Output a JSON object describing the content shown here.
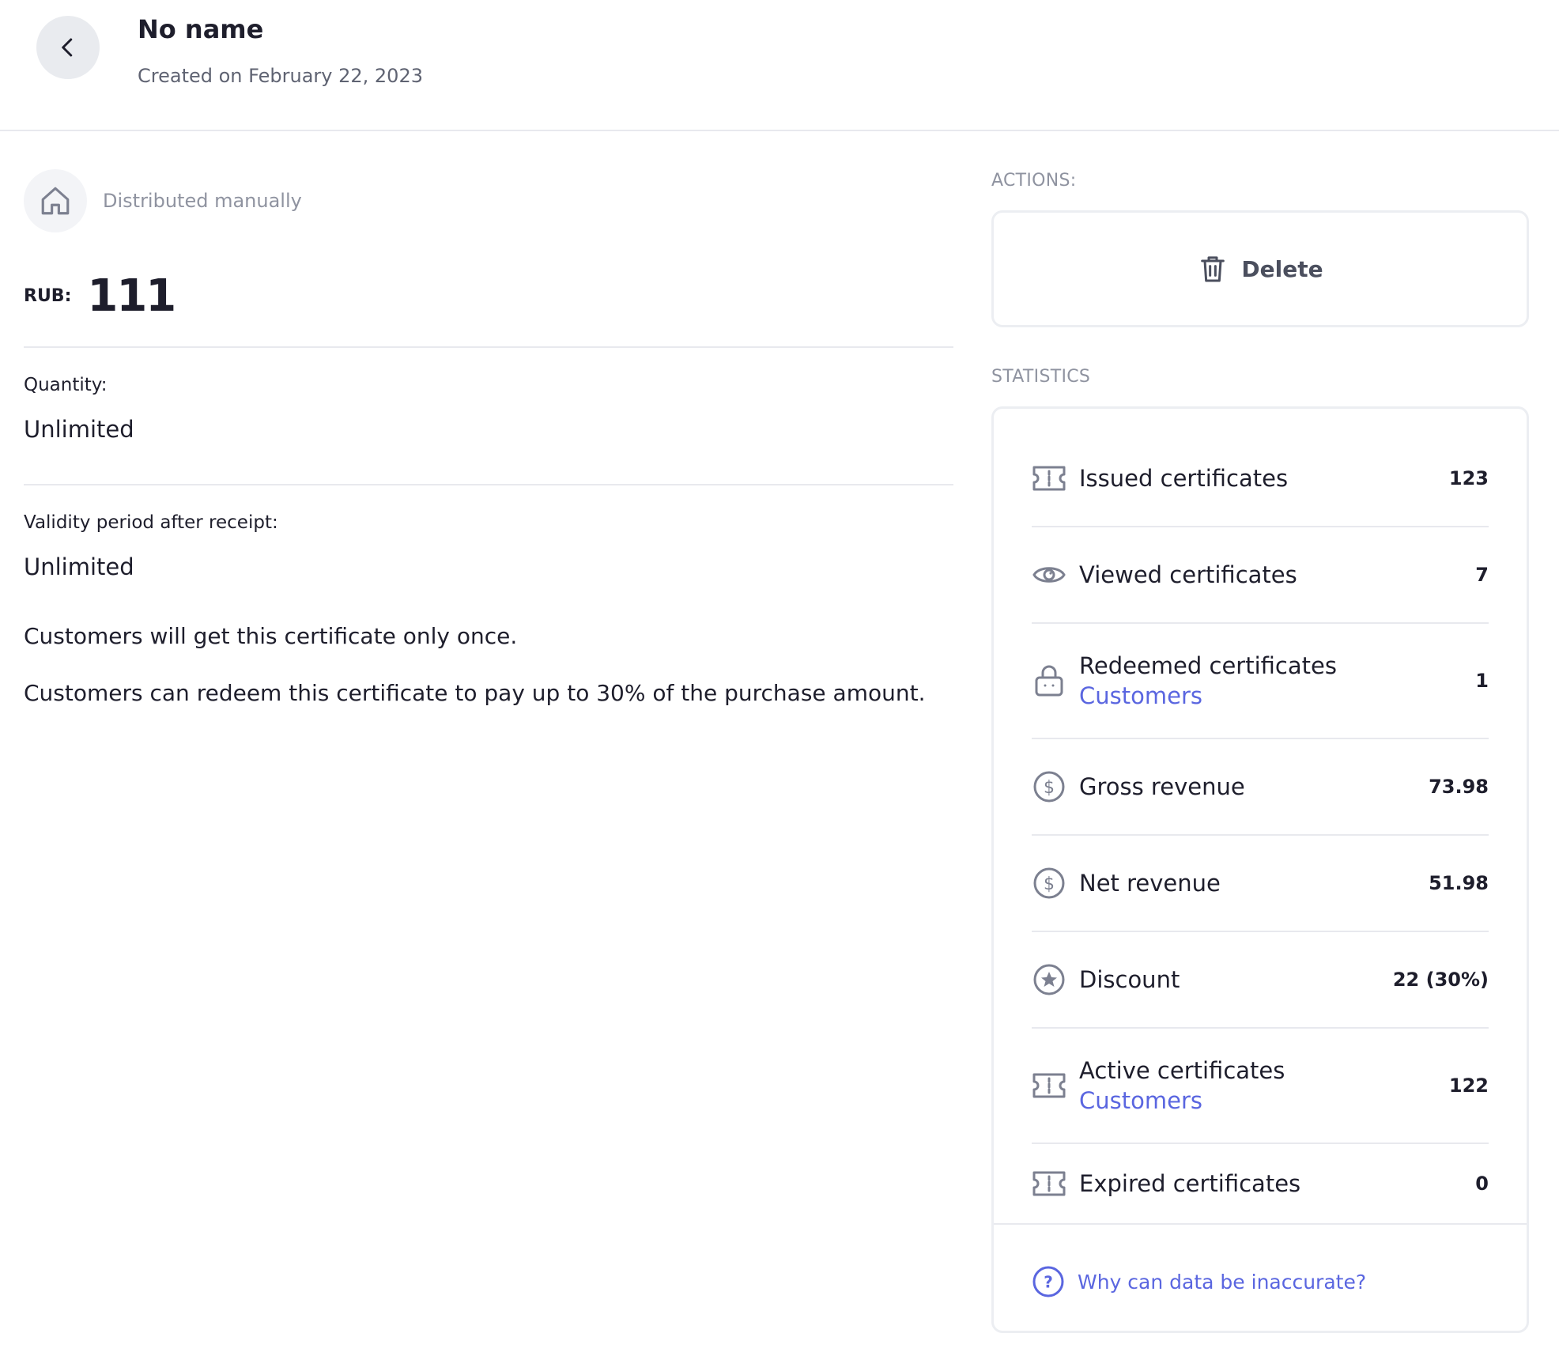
{
  "header": {
    "title": "No name",
    "subtitle": "Created on February 22, 2023"
  },
  "distribution": {
    "label": "Distributed manually",
    "icon": "home-icon"
  },
  "price": {
    "currency": "RUB:",
    "amount": "111"
  },
  "quantity": {
    "label": "Quantity:",
    "value": "Unlimited"
  },
  "validity": {
    "label": "Validity period after receipt:",
    "value": "Unlimited"
  },
  "info": {
    "once": "Customers will get this certificate only once.",
    "redeem": "Customers can redeem this certificate to pay up to 30% of the purchase amount."
  },
  "actions": {
    "section_label": "ACTIONS:",
    "delete_label": "Delete"
  },
  "statistics": {
    "section_label": "STATISTICS",
    "rows": [
      {
        "label": "Issued certificates",
        "value": "123",
        "icon": "ticket-icon"
      },
      {
        "label": "Viewed certificates",
        "value": "7",
        "icon": "eye-icon"
      },
      {
        "label": "Redeemed certificates",
        "link": "Customers",
        "value": "1",
        "icon": "lock-icon"
      },
      {
        "label": "Gross revenue",
        "value": "73.98",
        "icon": "dollar-icon"
      },
      {
        "label": "Net revenue",
        "value": "51.98",
        "icon": "dollar-icon"
      },
      {
        "label": "Discount",
        "value": "22 (30%)",
        "icon": "star-icon"
      },
      {
        "label": "Active certificates",
        "link": "Customers",
        "value": "122",
        "icon": "ticket-icon"
      },
      {
        "label": "Expired certificates",
        "value": "0",
        "icon": "ticket-icon"
      }
    ],
    "help_link": "Why can data be inaccurate?"
  },
  "colors": {
    "accent": "#5a66e0",
    "icon_gray": "#7c8090",
    "divider": "#e8e9ee"
  }
}
